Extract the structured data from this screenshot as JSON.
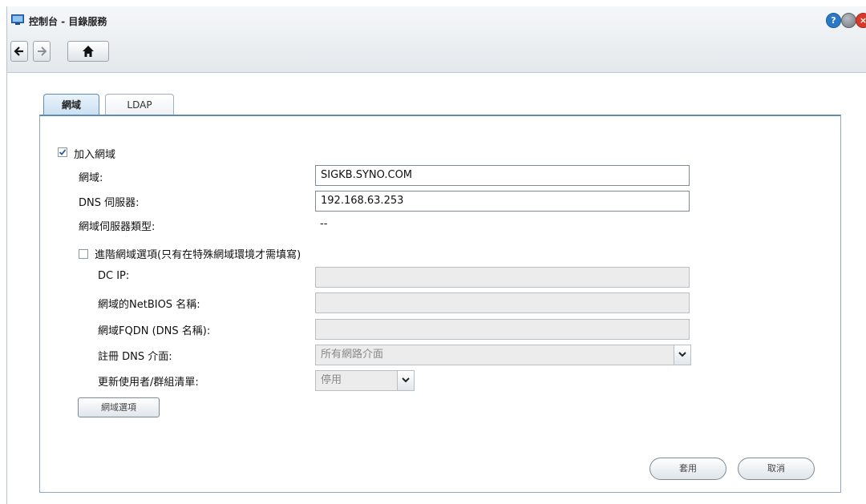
{
  "window": {
    "title": "控制台 - 目錄服務",
    "controls": {
      "help": "?",
      "minimize": "",
      "close": "×"
    },
    "colors": {
      "help": "#2a78c8",
      "minimize": "#8a9096",
      "close": "#d83a2a"
    }
  },
  "toolbar": {
    "back_icon": "arrow-left-icon",
    "forward_icon": "arrow-right-icon",
    "home_icon": "home-icon"
  },
  "tabs": [
    {
      "label": "網域",
      "active": true
    },
    {
      "label": "LDAP",
      "active": false
    }
  ],
  "form": {
    "join_domain": {
      "label": "加入網域",
      "checked": true
    },
    "domain": {
      "label": "網域:",
      "value": "SIGKB.SYNO.COM"
    },
    "dns_server": {
      "label": "DNS 伺服器:",
      "value": "192.168.63.253"
    },
    "server_type": {
      "label": "網域伺服器類型:",
      "value": "--"
    },
    "advanced": {
      "label": "進階網域選項(只有在特殊網域環境才需填寫)",
      "checked": false
    },
    "dc_ip": {
      "label": "DC IP:",
      "value": ""
    },
    "netbios": {
      "label": "網域的NetBIOS 名稱:",
      "value": ""
    },
    "fqdn": {
      "label": "網域FQDN (DNS 名稱):",
      "value": ""
    },
    "register_dns": {
      "label": "註冊 DNS 介面:",
      "selected": "所有網路介面"
    },
    "update_list": {
      "label": "更新使用者/群組清單:",
      "selected": "停用"
    },
    "domain_options_button": "網域選項"
  },
  "footer": {
    "apply": "套用",
    "cancel": "取消"
  }
}
